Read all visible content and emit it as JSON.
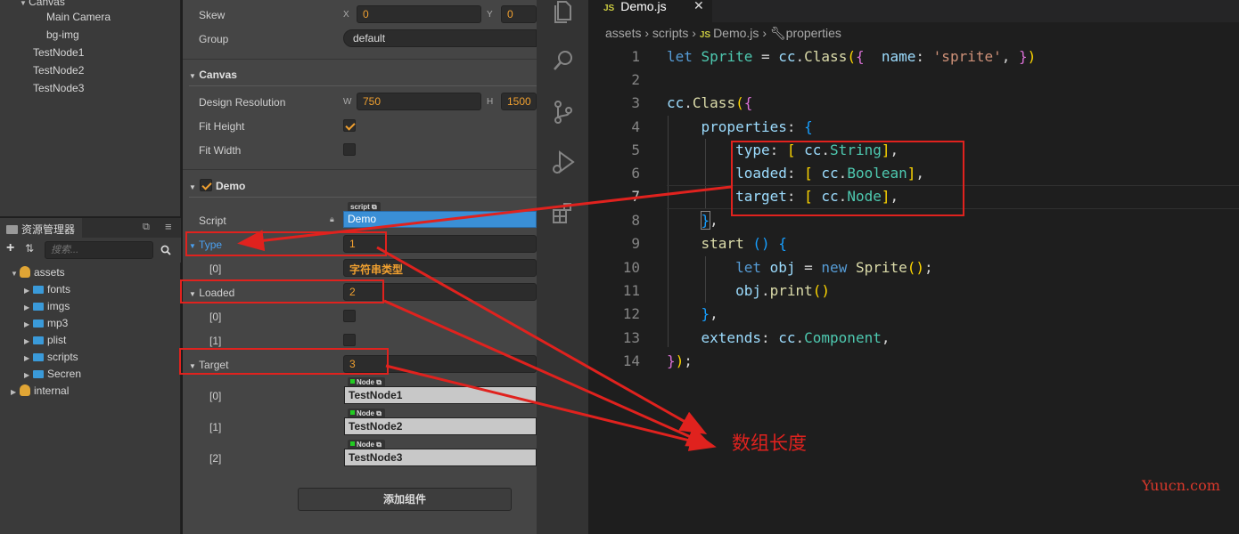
{
  "hierarchy": {
    "items": [
      {
        "label": "Canvas"
      },
      {
        "label": "Main Camera"
      },
      {
        "label": "bg-img"
      },
      {
        "label": "TestNode1"
      },
      {
        "label": "TestNode2"
      },
      {
        "label": "TestNode3"
      }
    ]
  },
  "assets_panel": {
    "tab_label": "资源管理器",
    "search_placeholder": "搜索...",
    "tree": [
      {
        "label": "assets",
        "icon": "database-icon",
        "expanded": true
      },
      {
        "label": "fonts",
        "icon": "folder-icon"
      },
      {
        "label": "imgs",
        "icon": "folder-icon"
      },
      {
        "label": "mp3",
        "icon": "folder-icon"
      },
      {
        "label": "plist",
        "icon": "folder-icon"
      },
      {
        "label": "scripts",
        "icon": "folder-icon"
      },
      {
        "label": "Secren",
        "icon": "folder-icon"
      },
      {
        "label": "internal",
        "icon": "database-icon",
        "expanded": false
      }
    ]
  },
  "inspector": {
    "skew": {
      "label": "Skew",
      "x_axis": "X",
      "x": "0",
      "y_axis": "Y",
      "y": "0"
    },
    "group": {
      "label": "Group",
      "value": "default"
    },
    "canvas": {
      "title": "Canvas",
      "design_resolution": {
        "label": "Design Resolution",
        "w_axis": "W",
        "w": "750",
        "h_axis": "H",
        "h": "1500"
      },
      "fit_height": {
        "label": "Fit Height",
        "checked": true
      },
      "fit_width": {
        "label": "Fit Width",
        "checked": false
      }
    },
    "demo": {
      "title": "Demo",
      "enabled": true,
      "script": {
        "label": "Script",
        "tag": "script",
        "value": "Demo"
      },
      "type_prop": {
        "label": "Type",
        "count": "1",
        "items": [
          {
            "index": "[0]",
            "value": "字符串类型"
          }
        ]
      },
      "loaded_prop": {
        "label": "Loaded",
        "count": "2",
        "items": [
          {
            "index": "[0]",
            "checked": false
          },
          {
            "index": "[1]",
            "checked": false
          }
        ]
      },
      "target_prop": {
        "label": "Target",
        "count": "3",
        "items": [
          {
            "index": "[0]",
            "tag": "Node",
            "value": "TestNode1"
          },
          {
            "index": "[1]",
            "tag": "Node",
            "value": "TestNode2"
          },
          {
            "index": "[2]",
            "tag": "Node",
            "value": "TestNode3"
          }
        ]
      }
    },
    "add_component_label": "添加组件"
  },
  "vscode": {
    "tab": {
      "badge": "JS",
      "title": "Demo.js"
    },
    "breadcrumb": {
      "parts": [
        "assets",
        "scripts",
        "Demo.js",
        "properties"
      ],
      "badge": "JS"
    },
    "line_numbers": [
      "1",
      "2",
      "3",
      "4",
      "5",
      "6",
      "7",
      "8",
      "9",
      "10",
      "11",
      "12",
      "13",
      "14"
    ],
    "current_line": 7
  },
  "annotation": {
    "label": "数组长度",
    "color": "#e0221e"
  },
  "watermark": "Yuucn.com",
  "colors": {
    "accent_orange": "#f0a030",
    "selection_blue": "#3a8fd6",
    "annotation_red": "#e0221e"
  }
}
